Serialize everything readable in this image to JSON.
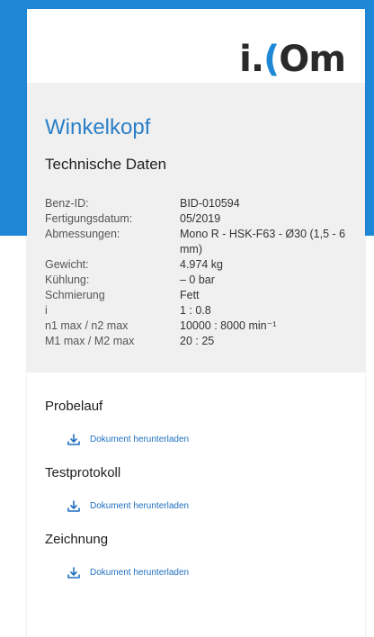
{
  "brand": {
    "logo_prefix": "i.",
    "logo_c": "(",
    "logo_o": "O",
    "logo_suffix": "m"
  },
  "product": {
    "title": "Winkelkopf",
    "section_title": "Technische Daten",
    "specs": [
      {
        "label": "Benz-ID:",
        "value": "BID-010594"
      },
      {
        "label": "Fertigungsdatum:",
        "value": "05/2019"
      },
      {
        "label": "Abmessungen:",
        "value": "Mono R - HSK-F63 - Ø30 (1,5 - 6 mm)"
      },
      {
        "label": "Gewicht:",
        "value": "4.974 kg"
      },
      {
        "label": "Kühlung:",
        "value": "– 0 bar"
      },
      {
        "label": "Schmierung",
        "value": "Fett"
      },
      {
        "label": "i",
        "value": "1 : 0.8"
      },
      {
        "label": "n1 max / n2 max",
        "value": "10000 : 8000 min⁻¹"
      },
      {
        "label": "M1 max / M2 max",
        "value": "20 : 25"
      }
    ]
  },
  "documents": [
    {
      "title": "Probelauf",
      "link": "Dokument herunterladen"
    },
    {
      "title": "Testprotokoll",
      "link": "Dokument herunterladen"
    },
    {
      "title": "Zeichnung",
      "link": "Dokument herunterladen"
    }
  ],
  "colors": {
    "brand_blue": "#1f88d6",
    "title_blue": "#2a7fc7",
    "link_blue": "#1f6fc0",
    "panel_gray": "#f0f0f0"
  }
}
